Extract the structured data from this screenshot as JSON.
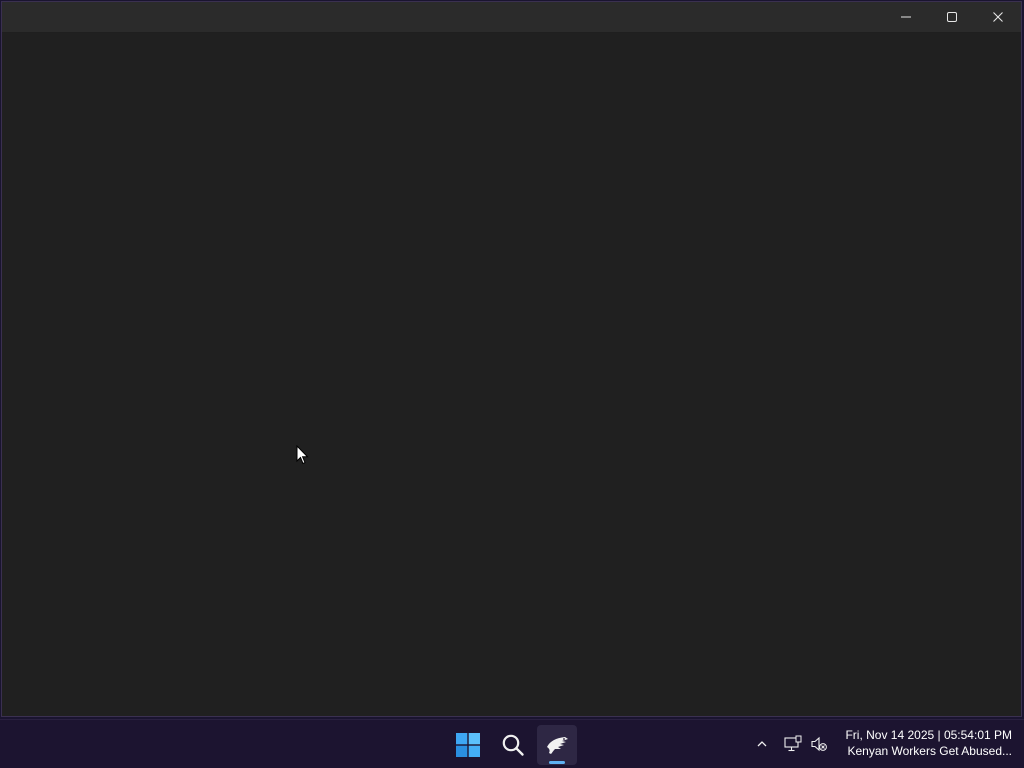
{
  "window": {
    "controls": {
      "minimize_icon": "minimize-icon",
      "maximize_icon": "maximize-icon",
      "close_icon": "close-icon"
    }
  },
  "taskbar": {
    "items": [
      "windows-start-icon",
      "search-icon",
      "app-icon"
    ],
    "tray_icons": [
      "chevron-up-icon",
      "network-icon",
      "volume-muted-icon"
    ],
    "clock": {
      "datetime": "Fri, Nov 14 2025 | 05:54:01 PM",
      "ticker": "Kenyan Workers Get Abused..."
    }
  },
  "colors": {
    "window_bg": "#202020",
    "titlebar_bg": "#2b2b2b",
    "taskbar_bg": "#1c1430",
    "accent": "#5fb2f2"
  }
}
